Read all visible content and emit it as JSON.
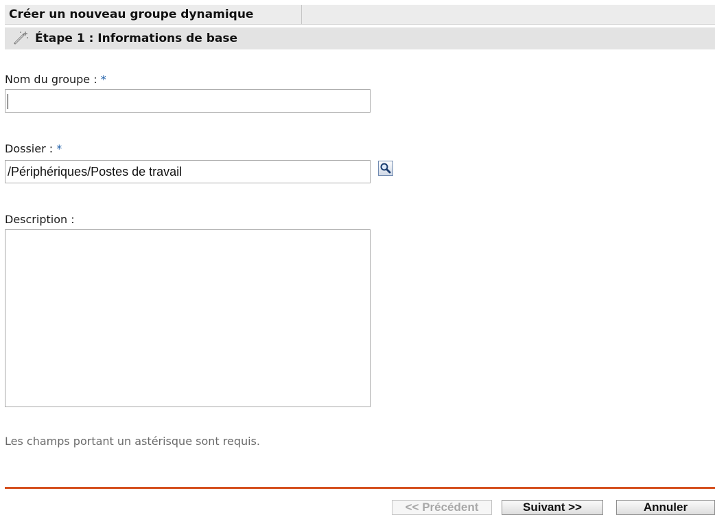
{
  "wizard": {
    "title": "Créer un nouveau groupe dynamique",
    "step_title": "Étape 1 : Informations de base"
  },
  "form": {
    "group_name": {
      "label": "Nom du groupe :",
      "required_mark": "*",
      "value": ""
    },
    "folder": {
      "label": "Dossier :",
      "required_mark": "*",
      "value": "/Périphériques/Postes de travail"
    },
    "description": {
      "label": "Description :",
      "value": ""
    },
    "required_note": "Les champs portant un astérisque sont requis."
  },
  "buttons": {
    "previous": "<< Précédent",
    "next": "Suivant >>",
    "cancel": "Annuler"
  },
  "colors": {
    "accent_divider": "#d5501f",
    "required_marker": "#1f5fa8"
  },
  "icons": {
    "step": "wizard-wand-icon",
    "browse": "magnifier-icon"
  }
}
